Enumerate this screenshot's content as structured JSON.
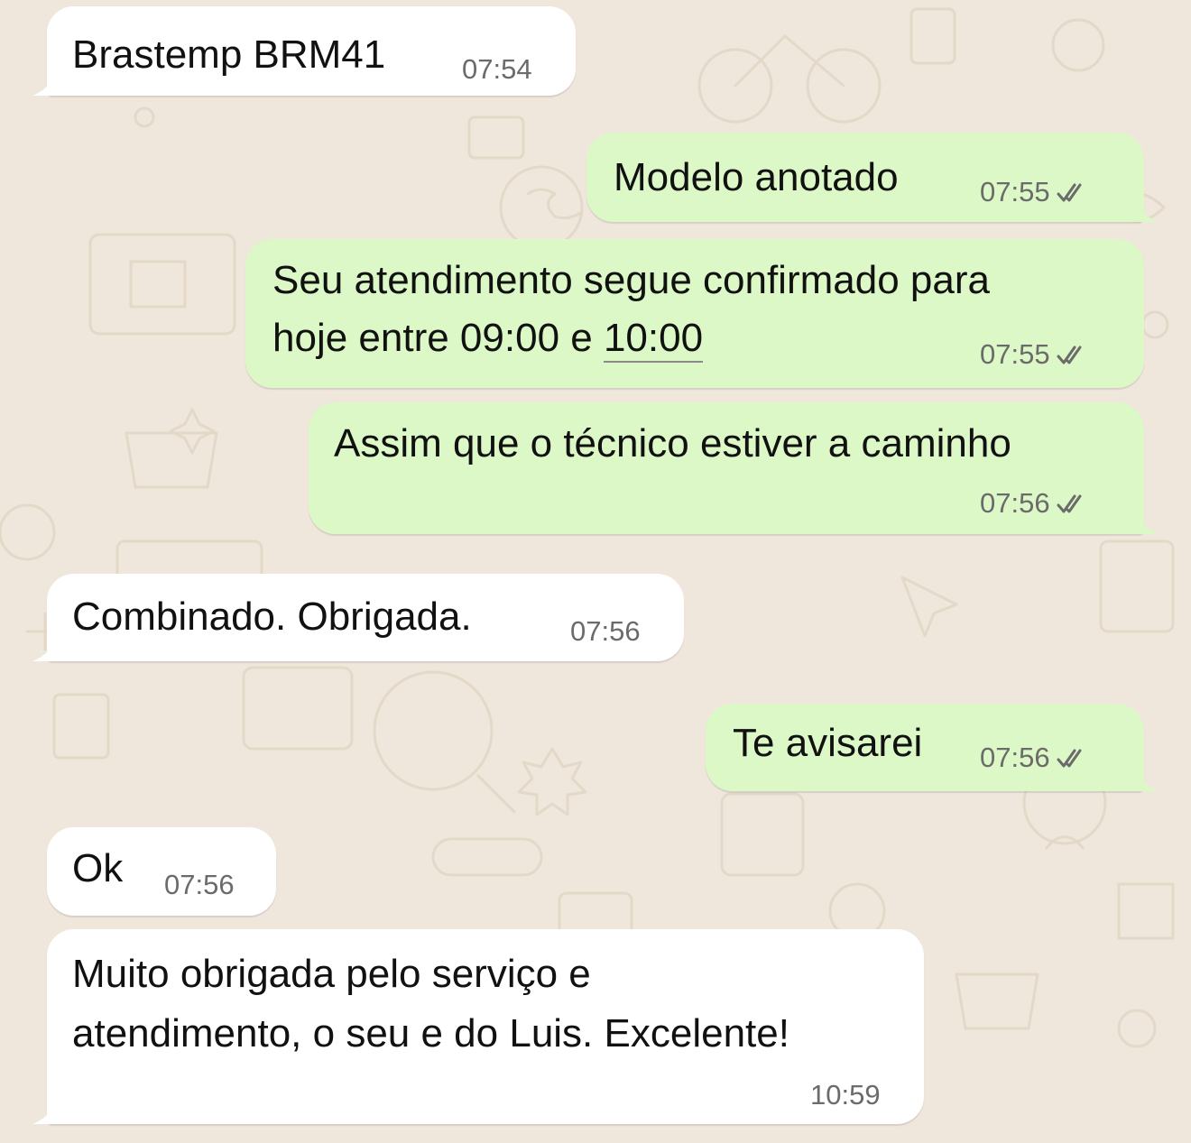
{
  "colors": {
    "wallpaper": "#efe7dc",
    "incoming_bubble": "#ffffff",
    "outgoing_bubble": "#dcf8c6",
    "timestamp": "#6b6b6b",
    "read_checks": "#6b6b6b"
  },
  "messages": [
    {
      "direction": "incoming",
      "text": "Brastemp BRM41",
      "time": "07:54"
    },
    {
      "direction": "outgoing",
      "text": "Modelo anotado",
      "time": "07:55",
      "status_icon": "double-check-icon"
    },
    {
      "direction": "outgoing",
      "line1": "Seu atendimento segue confirmado para",
      "line2_a": "hoje entre 09:00 e ",
      "line2_link": "10:00",
      "time": "07:55",
      "status_icon": "double-check-icon"
    },
    {
      "direction": "outgoing",
      "text": "Assim que o técnico estiver a caminho",
      "time": "07:56",
      "status_icon": "double-check-icon"
    },
    {
      "direction": "incoming",
      "text": "Combinado. Obrigada.",
      "time": "07:56"
    },
    {
      "direction": "outgoing",
      "text": "Te avisarei",
      "time": "07:56",
      "status_icon": "double-check-icon"
    },
    {
      "direction": "incoming",
      "text": "Ok",
      "time": "07:56"
    },
    {
      "direction": "incoming",
      "line1": "Muito obrigada pelo serviço e",
      "line2": "atendimento, o seu e do Luis. Excelente!",
      "time": "10:59"
    }
  ]
}
